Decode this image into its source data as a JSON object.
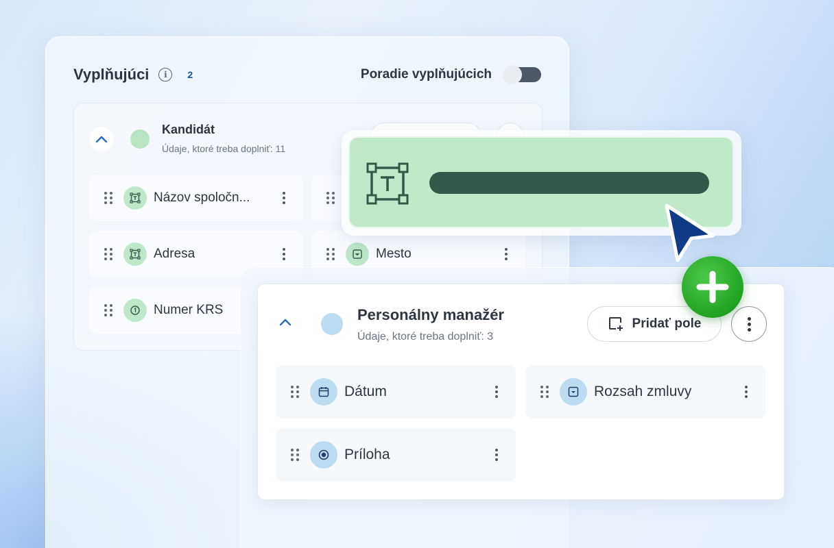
{
  "header": {
    "title": "Vyplňujúci",
    "count": "2",
    "toggle_label": "Poradie vyplňujúcich",
    "toggle_on": false
  },
  "section_candidate": {
    "name": "Kandidát",
    "subtitle": "Údaje, ktoré treba doplniť: 11",
    "fields": [
      {
        "label": "Názov spoločn...",
        "icon": "text-field-icon"
      },
      {
        "label": "Mesto",
        "icon": "dropdown-icon"
      },
      {
        "label": "Adresa",
        "icon": "text-field-icon"
      },
      {
        "label": "Numer KRS",
        "icon": "number-icon"
      }
    ]
  },
  "section_manager": {
    "name": "Personálny manažér",
    "subtitle": "Údaje, ktoré treba doplniť: 3",
    "add_field_label": "Pridať pole",
    "fields": [
      {
        "label": "Dátum",
        "icon": "calendar-icon"
      },
      {
        "label": "Rozsah zmluvy",
        "icon": "dropdown-icon"
      },
      {
        "label": "Príloha",
        "icon": "radio-icon"
      }
    ]
  },
  "colors": {
    "candidate_accent": "#bfe7c9",
    "manager_accent": "#bcdcf2",
    "plus_badge": "#22a323",
    "cursor": "#0f3a86"
  }
}
